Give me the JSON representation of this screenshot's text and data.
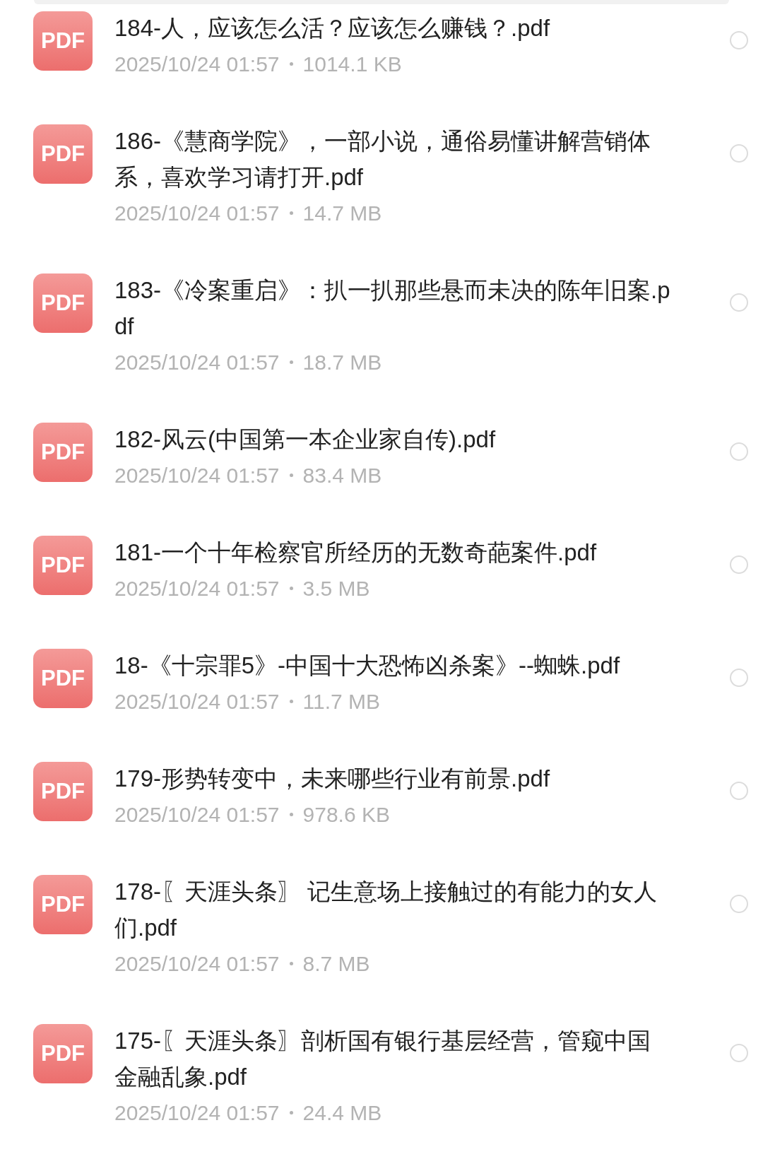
{
  "files": [
    {
      "badge": "PDF",
      "name": "184-人，应该怎么活？应该怎么赚钱？.pdf",
      "modified": "2025/10/24 01:57",
      "size": "1014.1 KB",
      "selected": false
    },
    {
      "badge": "PDF",
      "name": "186-《慧商学院》，一部小说，通俗易懂讲解营销体系，喜欢学习请打开.pdf",
      "modified": "2025/10/24 01:57",
      "size": "14.7 MB",
      "selected": false
    },
    {
      "badge": "PDF",
      "name": "183-《冷案重启》：扒一扒那些悬而未决的陈年旧案.pdf",
      "modified": "2025/10/24 01:57",
      "size": "18.7 MB",
      "selected": false
    },
    {
      "badge": "PDF",
      "name": "182-风云(中国第一本企业家自传).pdf",
      "modified": "2025/10/24 01:57",
      "size": "83.4 MB",
      "selected": false
    },
    {
      "badge": "PDF",
      "name": "181-一个十年检察官所经历的无数奇葩案件.pdf",
      "modified": "2025/10/24 01:57",
      "size": "3.5 MB",
      "selected": false
    },
    {
      "badge": "PDF",
      "name": "18-《十宗罪5》-中国十大恐怖凶杀案》--蜘蛛.pdf",
      "modified": "2025/10/24 01:57",
      "size": "11.7 MB",
      "selected": false
    },
    {
      "badge": "PDF",
      "name": "179-形势转变中，未来哪些行业有前景.pdf",
      "modified": "2025/10/24 01:57",
      "size": "978.6 KB",
      "selected": false
    },
    {
      "badge": "PDF",
      "name": "178-〖天涯头条〗 记生意场上接触过的有能力的女人们.pdf",
      "modified": "2025/10/24 01:57",
      "size": "8.7 MB",
      "selected": false
    },
    {
      "badge": "PDF",
      "name": "175-〖天涯头条〗剖析国有银行基层经营，管窥中国金融乱象.pdf",
      "modified": "2025/10/24 01:57",
      "size": "24.4 MB",
      "selected": false
    }
  ]
}
